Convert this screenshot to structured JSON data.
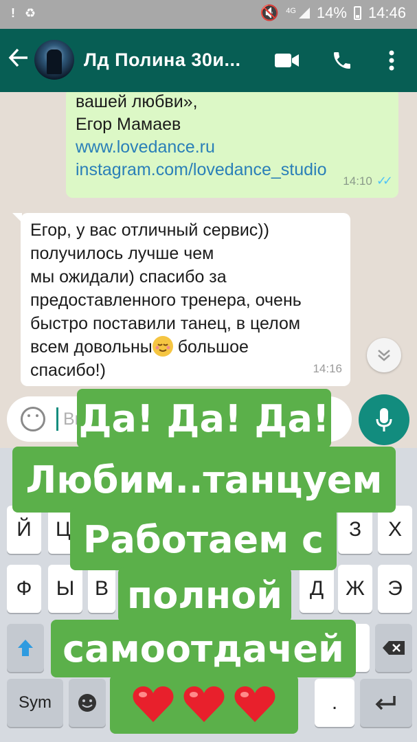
{
  "status_bar": {
    "network": "4G",
    "battery": "14%",
    "time": "14:46"
  },
  "header": {
    "title": "Лд Полина 30и...",
    "icons": [
      "back-arrow-icon",
      "video-call-icon",
      "phone-icon",
      "more-vert-icon"
    ]
  },
  "messages": [
    {
      "direction": "out",
      "lines": [
        "вашей любви»,",
        "Егор Мамаев",
        "www.lovedance.ru",
        "instagram.com/lovedance_studio"
      ],
      "time": "14:10",
      "status": "read"
    },
    {
      "direction": "in",
      "lines": [
        "Егор, у вас отличный сервис))",
        "получилось лучше чем",
        "мы ожидали) спасибо за",
        "предоставленного тренера, очень",
        "быстро поставили танец, в целом",
        "всем довольны",
        "большое",
        "спасибо!)"
      ],
      "time": "14:16"
    }
  ],
  "composer": {
    "placeholder": "Вв"
  },
  "keyboard": {
    "row1_visible": [
      "Й",
      "Ц",
      "З",
      "Х"
    ],
    "row2_visible": [
      "Ф",
      "Ы",
      "В",
      "Д",
      "Ж",
      "Э"
    ],
    "sym_label": "Sym",
    "period_label": "."
  },
  "overlay": {
    "lines": [
      "Да! Да! Да!",
      "Любим..танцуем",
      "Работаем с",
      "полной",
      "самоотдачей"
    ],
    "hearts": 3
  },
  "colors": {
    "header": "#075e54",
    "outgoing_bubble": "#dcf8c6",
    "incoming_bubble": "#ffffff",
    "accent": "#128c7e",
    "sticker": "#5bb04a"
  }
}
